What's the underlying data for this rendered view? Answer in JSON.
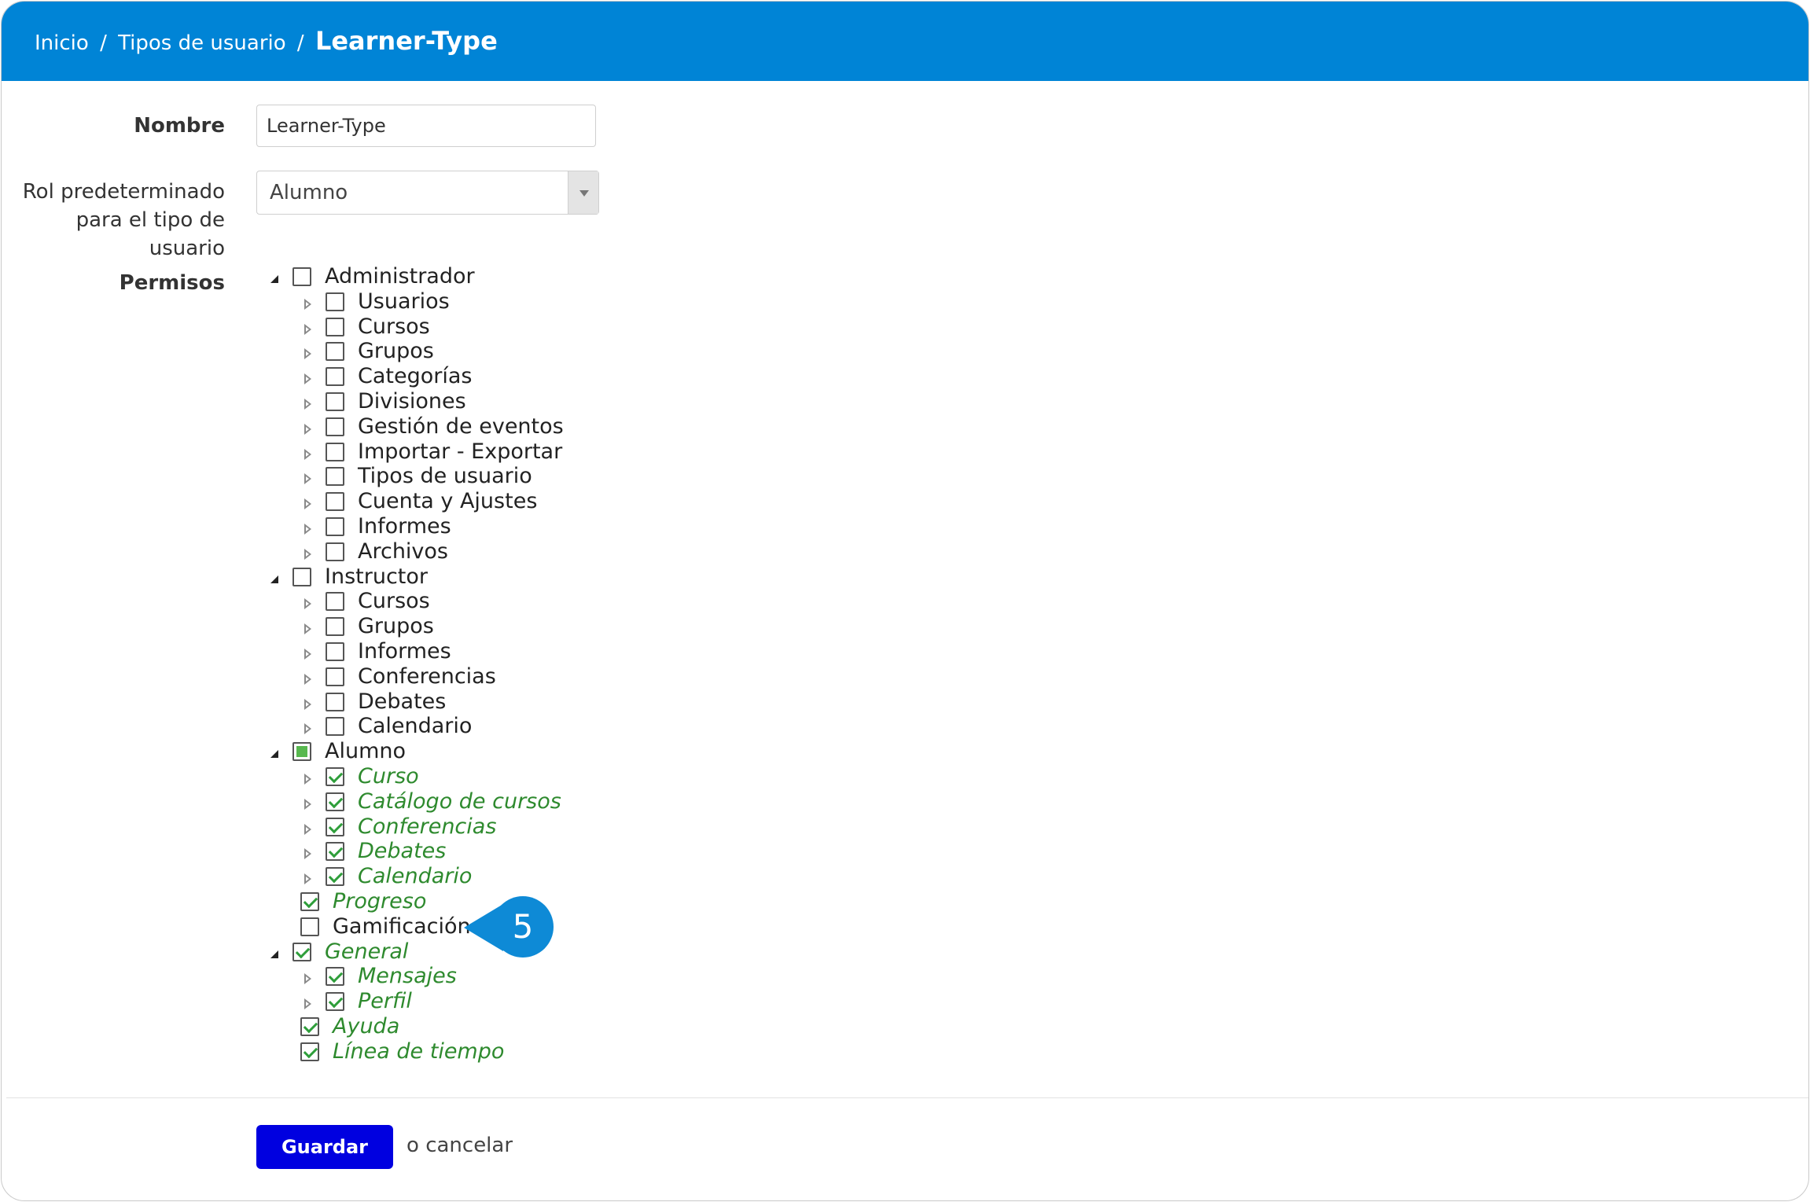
{
  "breadcrumb": {
    "home": "Inicio",
    "section": "Tipos de usuario",
    "current": "Learner-Type",
    "separator": "/"
  },
  "form": {
    "name_label": "Nombre",
    "name_value": "Learner-Type",
    "role_label_line1": "Rol predeterminado",
    "role_label_line2": "para el tipo de usuario",
    "role_value": "Alumno",
    "permissions_label": "Permisos"
  },
  "permissions": [
    {
      "label": "Administrador",
      "level": 0,
      "toggle": "open",
      "state": "unchecked"
    },
    {
      "label": "Usuarios",
      "level": 1,
      "toggle": "closed",
      "state": "unchecked"
    },
    {
      "label": "Cursos",
      "level": 1,
      "toggle": "closed",
      "state": "unchecked"
    },
    {
      "label": "Grupos",
      "level": 1,
      "toggle": "closed",
      "state": "unchecked"
    },
    {
      "label": "Categorías",
      "level": 1,
      "toggle": "closed",
      "state": "unchecked"
    },
    {
      "label": "Divisiones",
      "level": 1,
      "toggle": "closed",
      "state": "unchecked"
    },
    {
      "label": "Gestión de eventos",
      "level": 1,
      "toggle": "closed",
      "state": "unchecked"
    },
    {
      "label": "Importar - Exportar",
      "level": 1,
      "toggle": "closed",
      "state": "unchecked"
    },
    {
      "label": "Tipos de usuario",
      "level": 1,
      "toggle": "closed",
      "state": "unchecked"
    },
    {
      "label": "Cuenta y Ajustes",
      "level": 1,
      "toggle": "closed",
      "state": "unchecked"
    },
    {
      "label": "Informes",
      "level": 1,
      "toggle": "closed",
      "state": "unchecked"
    },
    {
      "label": "Archivos",
      "level": 1,
      "toggle": "closed",
      "state": "unchecked"
    },
    {
      "label": "Instructor",
      "level": 0,
      "toggle": "open",
      "state": "unchecked"
    },
    {
      "label": "Cursos",
      "level": 1,
      "toggle": "closed",
      "state": "unchecked"
    },
    {
      "label": "Grupos",
      "level": 1,
      "toggle": "closed",
      "state": "unchecked"
    },
    {
      "label": "Informes",
      "level": 1,
      "toggle": "closed",
      "state": "unchecked"
    },
    {
      "label": "Conferencias",
      "level": 1,
      "toggle": "closed",
      "state": "unchecked"
    },
    {
      "label": "Debates",
      "level": 1,
      "toggle": "closed",
      "state": "unchecked"
    },
    {
      "label": "Calendario",
      "level": 1,
      "toggle": "closed",
      "state": "unchecked"
    },
    {
      "label": "Alumno",
      "level": 0,
      "toggle": "open",
      "state": "partial"
    },
    {
      "label": "Curso",
      "level": 1,
      "toggle": "closed",
      "state": "checked"
    },
    {
      "label": "Catálogo de cursos",
      "level": 1,
      "toggle": "closed",
      "state": "checked"
    },
    {
      "label": "Conferencias",
      "level": 1,
      "toggle": "closed",
      "state": "checked"
    },
    {
      "label": "Debates",
      "level": 1,
      "toggle": "closed",
      "state": "checked"
    },
    {
      "label": "Calendario",
      "level": 1,
      "toggle": "closed",
      "state": "checked"
    },
    {
      "label": "Progreso",
      "level": 1,
      "toggle": "none",
      "state": "checked"
    },
    {
      "label": "Gamificación",
      "level": 1,
      "toggle": "none",
      "state": "unchecked"
    },
    {
      "label": "General",
      "level": 0,
      "toggle": "open",
      "state": "checked"
    },
    {
      "label": "Mensajes",
      "level": 1,
      "toggle": "closed",
      "state": "checked"
    },
    {
      "label": "Perfil",
      "level": 1,
      "toggle": "closed",
      "state": "checked"
    },
    {
      "label": "Ayuda",
      "level": 1,
      "toggle": "none",
      "state": "checked"
    },
    {
      "label": "Línea de tiempo",
      "level": 1,
      "toggle": "none",
      "state": "checked"
    }
  ],
  "callout": {
    "number": "5"
  },
  "footer": {
    "save_label": "Guardar",
    "or_text": "o",
    "cancel_label": "cancelar"
  },
  "colors": {
    "header": "#0084d6",
    "save_button": "#0000e0",
    "checked_text": "#2e8a2e",
    "callout": "#0e8ad6"
  }
}
